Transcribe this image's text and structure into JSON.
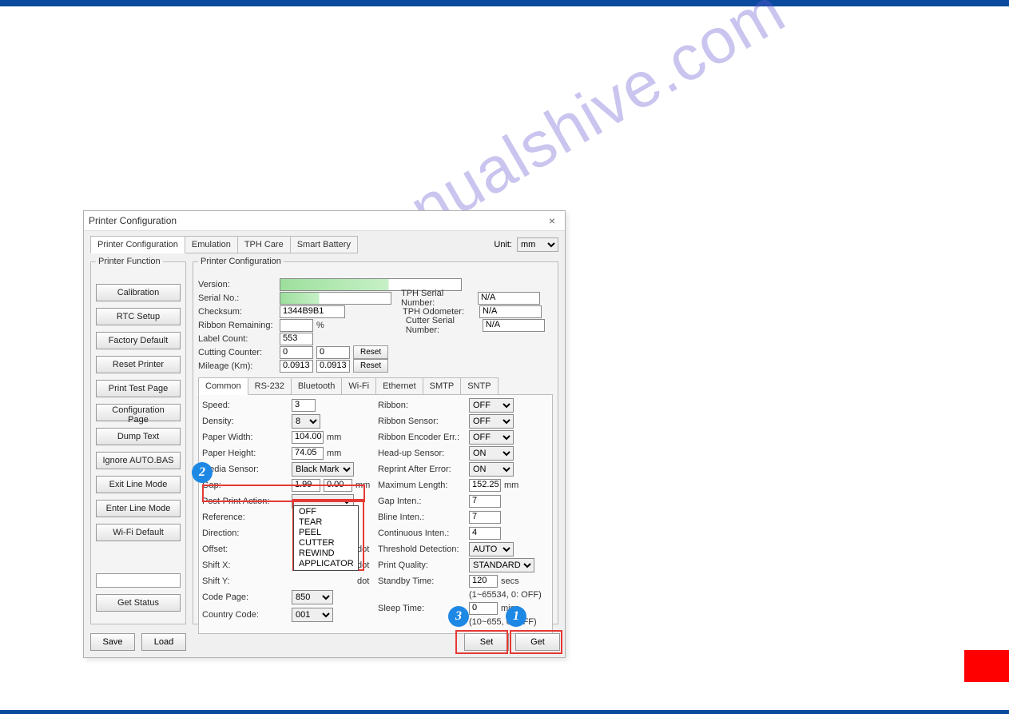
{
  "dialog_title": "Printer Configuration",
  "top_tabs": {
    "printer_config": "Printer Configuration",
    "emulation": "Emulation",
    "tph_care": "TPH Care",
    "smart_battery": "Smart Battery"
  },
  "unit_label": "Unit:",
  "unit_value": "mm",
  "printer_function_legend": "Printer Function",
  "left_buttons": {
    "calibration": "Calibration",
    "rtc_setup": "RTC Setup",
    "factory_default": "Factory Default",
    "reset_printer": "Reset Printer",
    "print_test_page": "Print Test Page",
    "configuration_page": "Configuration Page",
    "dump_text": "Dump Text",
    "ignore_autobas": "Ignore AUTO.BAS",
    "exit_line_mode": "Exit Line Mode",
    "enter_line_mode": "Enter Line Mode",
    "wifi_default": "Wi-Fi Default",
    "get_status": "Get Status"
  },
  "printer_config_legend": "Printer Configuration",
  "info": {
    "version_lbl": "Version:",
    "serial_no_lbl": "Serial No.:",
    "checksum_lbl": "Checksum:",
    "checksum_val": "1344B9B1",
    "ribbon_remaining_lbl": "Ribbon Remaining:",
    "percent": "%",
    "label_count_lbl": "Label Count:",
    "label_count_val": "553",
    "cutting_counter_lbl": "Cutting Counter:",
    "cutting_a": "0",
    "cutting_b": "0",
    "reset": "Reset",
    "mileage_lbl": "Mileage (Km):",
    "mileage_a": "0.0913",
    "mileage_b": "0.0913",
    "tph_serial_lbl": "TPH Serial Number:",
    "tph_serial_val": "N/A",
    "tph_odo_lbl": "TPH Odometer:",
    "tph_odo_val": "N/A",
    "cutter_serial_lbl": "Cutter Serial Number:",
    "cutter_serial_val": "N/A"
  },
  "sub_tabs": {
    "common": "Common",
    "rs232": "RS-232",
    "bluetooth": "Bluetooth",
    "wifi": "Wi-Fi",
    "ethernet": "Ethernet",
    "smtp": "SMTP",
    "sntp": "SNTP"
  },
  "common_left": {
    "speed_lbl": "Speed:",
    "speed_val": "3",
    "density_lbl": "Density:",
    "density_val": "8",
    "paper_w_lbl": "Paper Width:",
    "paper_w_val": "104.00",
    "paper_h_lbl": "Paper Height:",
    "paper_h_val": "74.05",
    "media_sensor_lbl": "Media Sensor:",
    "media_sensor_val": "Black Mark",
    "gap_lbl": "Gap:",
    "gap_a": "1.99",
    "gap_b": "0.00",
    "post_print_lbl": "Post-Print Action:",
    "reference_lbl": "Reference:",
    "direction_lbl": "Direction:",
    "offset_lbl": "Offset:",
    "shift_x_lbl": "Shift X:",
    "shift_y_lbl": "Shift Y:",
    "code_page_lbl": "Code Page:",
    "code_page_val": "850",
    "country_code_lbl": "Country Code:",
    "country_code_val": "001",
    "mm": "mm",
    "dot": "dot"
  },
  "post_print_options": {
    "off": "OFF",
    "tear": "TEAR",
    "peel": "PEEL",
    "cutter": "CUTTER",
    "rewind": "REWIND",
    "applicator": "APPLICATOR"
  },
  "common_right": {
    "ribbon_lbl": "Ribbon:",
    "ribbon_val": "OFF",
    "ribbon_sensor_lbl": "Ribbon Sensor:",
    "ribbon_sensor_val": "OFF",
    "ribbon_enc_lbl": "Ribbon Encoder Err.:",
    "ribbon_enc_val": "OFF",
    "headup_lbl": "Head-up Sensor:",
    "headup_val": "ON",
    "reprint_lbl": "Reprint After Error:",
    "reprint_val": "ON",
    "max_len_lbl": "Maximum Length:",
    "max_len_val": "152.25",
    "gap_inten_lbl": "Gap Inten.:",
    "gap_inten_val": "7",
    "bline_inten_lbl": "Bline Inten.:",
    "bline_inten_val": "7",
    "cont_inten_lbl": "Continuous Inten.:",
    "cont_inten_val": "4",
    "threshold_lbl": "Threshold Detection:",
    "threshold_val": "AUTO",
    "print_q_lbl": "Print Quality:",
    "print_q_val": "STANDARD",
    "standby_lbl": "Standby Time:",
    "standby_val": "120",
    "secs": "secs",
    "standby_hint": "(1~65534, 0: OFF)",
    "sleep_lbl": "Sleep Time:",
    "sleep_val": "0",
    "mins": "mins",
    "sleep_hint": "(10~655, 0: OFF)",
    "mm": "mm"
  },
  "bottom": {
    "save": "Save",
    "load": "Load",
    "set": "Set",
    "get": "Get"
  },
  "callouts": {
    "one": "1",
    "two": "2",
    "three": "3"
  },
  "watermark": "manualshive.com"
}
